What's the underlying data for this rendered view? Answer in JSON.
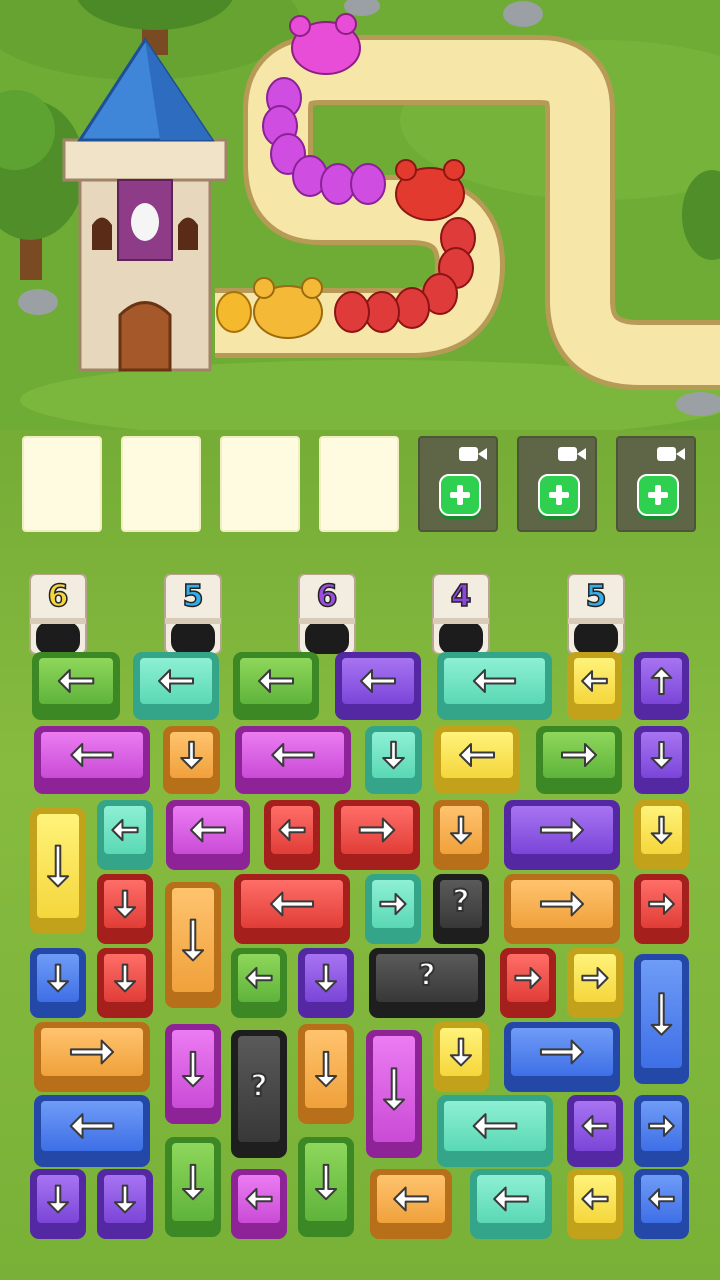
{
  "colors": {
    "green": [
      "#8ed75b",
      "#5fb33b",
      "#3c8824"
    ],
    "teal": [
      "#8ef0d4",
      "#5ad8b5",
      "#35a58a"
    ],
    "purple": [
      "#a774f2",
      "#7b45d8",
      "#5528a3"
    ],
    "magenta": [
      "#ec7cf2",
      "#c94bd6",
      "#8e2398"
    ],
    "yellow": [
      "#fff37a",
      "#f5d63c",
      "#c2a21b"
    ],
    "orange": [
      "#ffc36e",
      "#f0a13b",
      "#b86f19"
    ],
    "red": [
      "#ff6e68",
      "#e13d37",
      "#a51f1c"
    ],
    "blue": [
      "#6f9cf7",
      "#3e6fe6",
      "#2448a8"
    ],
    "gray": [
      "#5a5a5a",
      "#383838",
      "#1e1e1e"
    ]
  },
  "board": {
    "slots": [
      {
        "state": "empty"
      },
      {
        "state": "empty"
      },
      {
        "state": "empty"
      },
      {
        "state": "empty"
      },
      {
        "state": "locked",
        "icon": "video-camera-icon",
        "action": "add-slot-plus-icon"
      },
      {
        "state": "locked",
        "icon": "video-camera-icon",
        "action": "add-slot-plus-icon"
      },
      {
        "state": "locked",
        "icon": "video-camera-icon",
        "action": "add-slot-plus-icon"
      }
    ],
    "gates": [
      {
        "count": "6",
        "color": "#f5d63c"
      },
      {
        "count": "5",
        "color": "#35aee8"
      },
      {
        "count": "6",
        "color": "#9b4de0"
      },
      {
        "count": "4",
        "color": "#8b45d8"
      },
      {
        "count": "5",
        "color": "#35aee8"
      }
    ],
    "tiles": [
      {
        "c": "green",
        "dir": "left"
      },
      {
        "c": "teal",
        "dir": "left"
      },
      {
        "c": "green",
        "dir": "left"
      },
      {
        "c": "purple",
        "dir": "left"
      },
      {
        "c": "teal",
        "dir": "left"
      },
      {
        "c": "yellow",
        "dir": "left"
      },
      {
        "c": "purple",
        "dir": "up"
      },
      {
        "c": "magenta",
        "dir": "left"
      },
      {
        "c": "orange",
        "dir": "down"
      },
      {
        "c": "magenta",
        "dir": "left"
      },
      {
        "c": "teal",
        "dir": "down"
      },
      {
        "c": "yellow",
        "dir": "left"
      },
      {
        "c": "green",
        "dir": "right"
      },
      {
        "c": "purple",
        "dir": "down"
      },
      {
        "c": "yellow",
        "dir": "down"
      },
      {
        "c": "teal",
        "dir": "left"
      },
      {
        "c": "magenta",
        "dir": "left"
      },
      {
        "c": "red",
        "dir": "left"
      },
      {
        "c": "red",
        "dir": "right"
      },
      {
        "c": "orange",
        "dir": "down"
      },
      {
        "c": "purple",
        "dir": "right"
      },
      {
        "c": "yellow",
        "dir": "down"
      },
      {
        "c": "red",
        "dir": "down"
      },
      {
        "c": "orange",
        "dir": "down"
      },
      {
        "c": "red",
        "dir": "left"
      },
      {
        "c": "teal",
        "dir": "right"
      },
      {
        "c": "gray",
        "dir": "?",
        "label": "?"
      },
      {
        "c": "orange",
        "dir": "right"
      },
      {
        "c": "red",
        "dir": "right"
      },
      {
        "c": "blue",
        "dir": "down"
      },
      {
        "c": "red",
        "dir": "down"
      },
      {
        "c": "green",
        "dir": "left"
      },
      {
        "c": "purple",
        "dir": "down"
      },
      {
        "c": "gray",
        "dir": "?",
        "label": "?"
      },
      {
        "c": "red",
        "dir": "right"
      },
      {
        "c": "yellow",
        "dir": "right"
      },
      {
        "c": "blue",
        "dir": "down"
      },
      {
        "c": "orange",
        "dir": "right"
      },
      {
        "c": "magenta",
        "dir": "down"
      },
      {
        "c": "gray",
        "dir": "?",
        "label": "?"
      },
      {
        "c": "orange",
        "dir": "down"
      },
      {
        "c": "magenta",
        "dir": "down"
      },
      {
        "c": "yellow",
        "dir": "down"
      },
      {
        "c": "blue",
        "dir": "right"
      },
      {
        "c": "blue",
        "dir": "left"
      },
      {
        "c": "teal",
        "dir": "left"
      },
      {
        "c": "purple",
        "dir": "left"
      },
      {
        "c": "blue",
        "dir": "right"
      },
      {
        "c": "purple",
        "dir": "down"
      },
      {
        "c": "purple",
        "dir": "down"
      },
      {
        "c": "green",
        "dir": "down"
      },
      {
        "c": "magenta",
        "dir": "left"
      },
      {
        "c": "green",
        "dir": "down"
      },
      {
        "c": "orange",
        "dir": "left"
      },
      {
        "c": "teal",
        "dir": "left"
      },
      {
        "c": "yellow",
        "dir": "left"
      },
      {
        "c": "blue",
        "dir": "left"
      }
    ]
  }
}
